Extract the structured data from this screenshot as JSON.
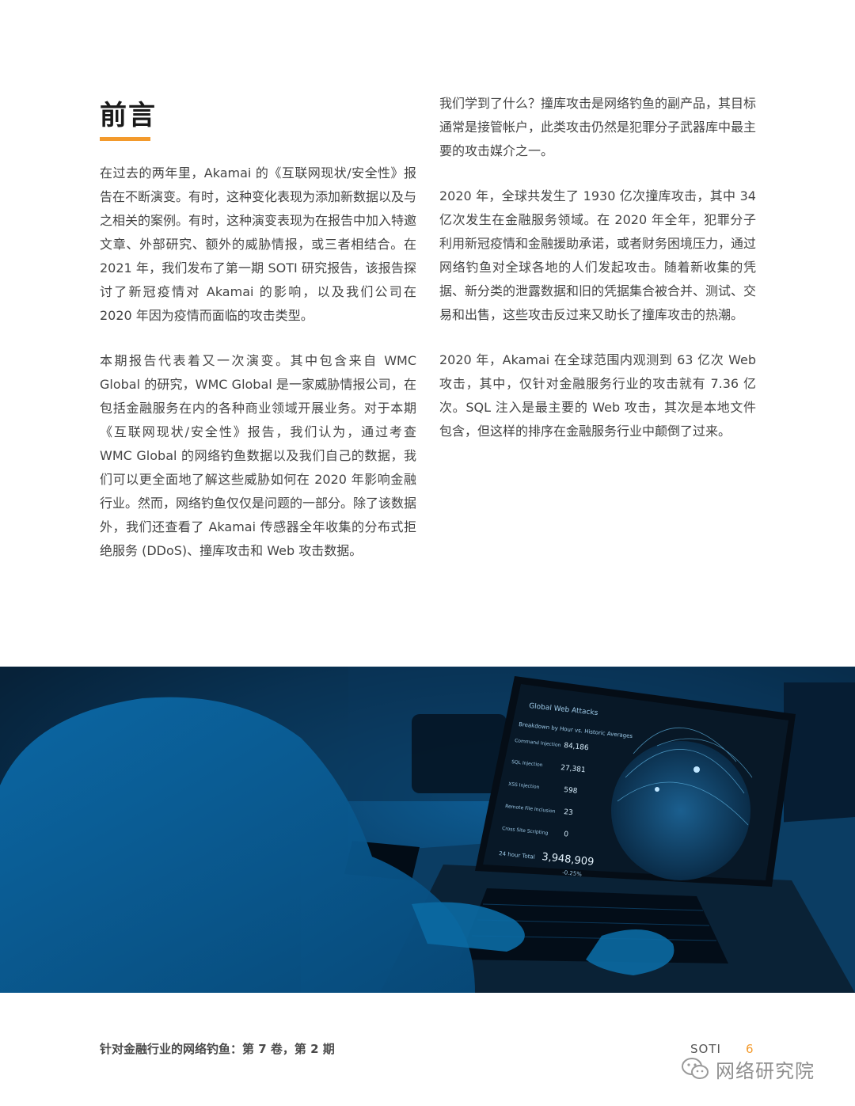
{
  "heading": "前言",
  "left_column": [
    "在过去的两年里，Akamai 的《互联网现状/安全性》报告在不断演变。有时，这种变化表现为添加新数据以及与之相关的案例。有时，这种演变表现为在报告中加入特邀文章、外部研究、额外的威胁情报，或三者相结合。在 2021 年，我们发布了第一期 SOTI 研究报告，该报告探讨了新冠疫情对 Akamai 的影响，以及我们公司在 2020 年因为疫情而面临的攻击类型。",
    "本期报告代表着又一次演变。其中包含来自 WMC Global 的研究，WMC Global 是一家威胁情报公司，在包括金融服务在内的各种商业领域开展业务。对于本期《互联网现状/安全性》报告，我们认为，通过考查 WMC Global 的网络钓鱼数据以及我们自己的数据，我们可以更全面地了解这些威胁如何在 2020 年影响金融行业。然而，网络钓鱼仅仅是问题的一部分。除了该数据外，我们还查看了 Akamai 传感器全年收集的分布式拒绝服务 (DDoS)、撞库攻击和 Web 攻击数据。"
  ],
  "right_column": [
    "我们学到了什么？撞库攻击是网络钓鱼的副产品，其目标通常是接管帐户，此类攻击仍然是犯罪分子武器库中最主要的攻击媒介之一。",
    "2020 年，全球共发生了 1930 亿次撞库攻击，其中 34 亿次发生在金融服务领域。在 2020 年全年，犯罪分子利用新冠疫情和金融援助承诺，或者财务困境压力，通过网络钓鱼对全球各地的人们发起攻击。随着新收集的凭据、新分类的泄露数据和旧的凭据集合被合并、测试、交易和出售，这些攻击反过来又助长了撞库攻击的热潮。",
    "2020 年，Akamai 在全球范围内观测到 63 亿次 Web 攻击，其中，仅针对金融服务行业的攻击就有 7.36 亿次。SQL 注入是最主要的 Web 攻击，其次是本地文件包含，但这样的排序在金融服务行业中颠倒了过来。"
  ],
  "dashboard": {
    "app_title": "Global Web Attacks",
    "subtitle": "Breakdown by Hour vs. Historic Averages",
    "rows": [
      {
        "label": "Command Injection",
        "value": "84,186"
      },
      {
        "label": "SQL Injection",
        "value": "27,381"
      },
      {
        "label": "XSS Injection",
        "value": "598"
      },
      {
        "label": "Remote File Inclusion",
        "value": "23"
      },
      {
        "label": "Cross Site Scripting",
        "value": "0"
      }
    ],
    "total_label": "24 hour Total",
    "total_value": "3,948,909",
    "total_change": "-0.25%"
  },
  "footer": {
    "title": "针对金融行业的网络钓鱼：第 7 卷，第 2 期",
    "brand": "SOTI",
    "page": "6"
  },
  "watermark": {
    "text": "网络研究院",
    "icon": "wechat-icon"
  },
  "colors": {
    "accent": "#f39a2c",
    "photo_tint": "#0a4a78"
  }
}
